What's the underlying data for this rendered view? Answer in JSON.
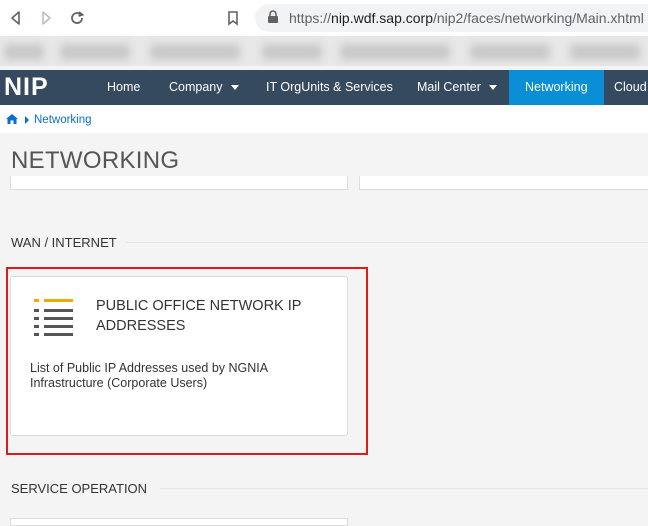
{
  "browser": {
    "url_scheme": "https://",
    "url_host": "nip.wdf.sap.corp",
    "url_path": "/nip2/faces/networking/Main.xhtml"
  },
  "app": {
    "logo": "NIP",
    "nav": {
      "home": "Home",
      "company": "Company",
      "it_orgunits": "IT OrgUnits & Services",
      "mail_center": "Mail Center",
      "networking": "Networking",
      "cloud": "Cloud"
    },
    "colors": {
      "navbar": "#354a5f",
      "active_tab": "#0a8fd6",
      "link": "#0a6ed1",
      "highlight": "#e01b1b",
      "icon_accent": "#f0ab00"
    }
  },
  "breadcrumb": {
    "current": "Networking"
  },
  "page": {
    "title": "NETWORKING"
  },
  "sections": {
    "wan": {
      "title": "WAN / INTERNET",
      "tile": {
        "icon": "list-icon",
        "title": "PUBLIC OFFICE NETWORK IP ADDRESSES",
        "description": "List of Public IP Addresses used by NGNIA Infrastructure (Corporate Users)"
      }
    },
    "service": {
      "title": "SERVICE OPERATION"
    }
  }
}
